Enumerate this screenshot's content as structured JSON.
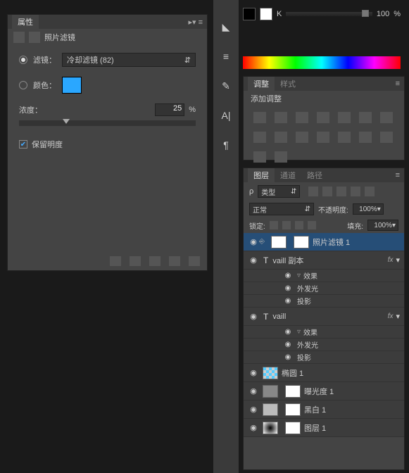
{
  "topbar": {
    "k_label": "K",
    "k_value": "100",
    "k_unit": "%"
  },
  "props_panel": {
    "tab": "属性",
    "title": "照片滤镜",
    "filter_radio": "滤镜：",
    "filter_value": "冷却滤镜 (82)",
    "color_radio": "颜色：",
    "color_hex": "#2aa7ff",
    "density_label": "浓度：",
    "density_value": "25",
    "density_unit": "%",
    "preserve_label": "保留明度"
  },
  "adjust_panel": {
    "tabs": {
      "active": "调整",
      "other": "样式"
    },
    "title": "添加调整"
  },
  "layers_panel": {
    "tabs": {
      "active": "图层",
      "channels": "通道",
      "paths": "路径"
    },
    "kind_label": "类型",
    "blend_label": "正常",
    "opacity_label": "不透明度:",
    "opacity_value": "100%",
    "lock_label": "锁定:",
    "fill_label": "填充:",
    "fill_value": "100%",
    "layers": [
      {
        "name": "照片滤镜 1",
        "selected": true,
        "thumb": "mask",
        "linked": true
      },
      {
        "name": "vaill 副本",
        "text": true,
        "fx": true,
        "effects": [
          "效果",
          "外发光",
          "投影"
        ]
      },
      {
        "name": "vaill",
        "text": true,
        "fx": true,
        "effects": [
          "效果",
          "外发光",
          "投影"
        ]
      },
      {
        "name": "椭圆 1",
        "thumb": "checker"
      },
      {
        "name": "曝光度 1",
        "thumb": "exp",
        "mask": true
      },
      {
        "name": "黑白 1",
        "thumb": "bw",
        "mask": true
      },
      {
        "name": "图层 1",
        "thumb": "grad",
        "mask": true
      }
    ],
    "search_icon": "ρ"
  }
}
